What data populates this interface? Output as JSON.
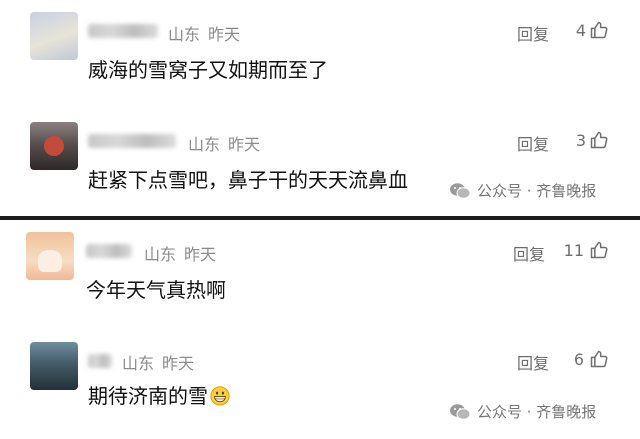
{
  "comments": [
    {
      "location": "山东",
      "time": "昨天",
      "text": "威海的雪窝子又如期而至了",
      "reply_label": "回复",
      "likes": "4"
    },
    {
      "location": "山东",
      "time": "昨天",
      "text": "赶紧下点雪吧，鼻子干的天天流鼻血",
      "reply_label": "回复",
      "likes": "3"
    },
    {
      "location": "山东",
      "time": "昨天",
      "text": "今年天气真热啊",
      "reply_label": "回复",
      "likes": "11"
    },
    {
      "location": "山东",
      "time": "昨天",
      "text": "期待济南的雪",
      "reply_label": "回复",
      "likes": "6",
      "emoji": "grinning-face"
    }
  ],
  "watermark": {
    "label": "公众号 · 齐鲁晚报"
  },
  "colors": {
    "divider": "#1c1c1c",
    "meta": "#8c8c8c",
    "text": "#111111"
  },
  "icons": {
    "like": "thumbs-up-outline-icon",
    "watermark": "wechat-icon"
  }
}
